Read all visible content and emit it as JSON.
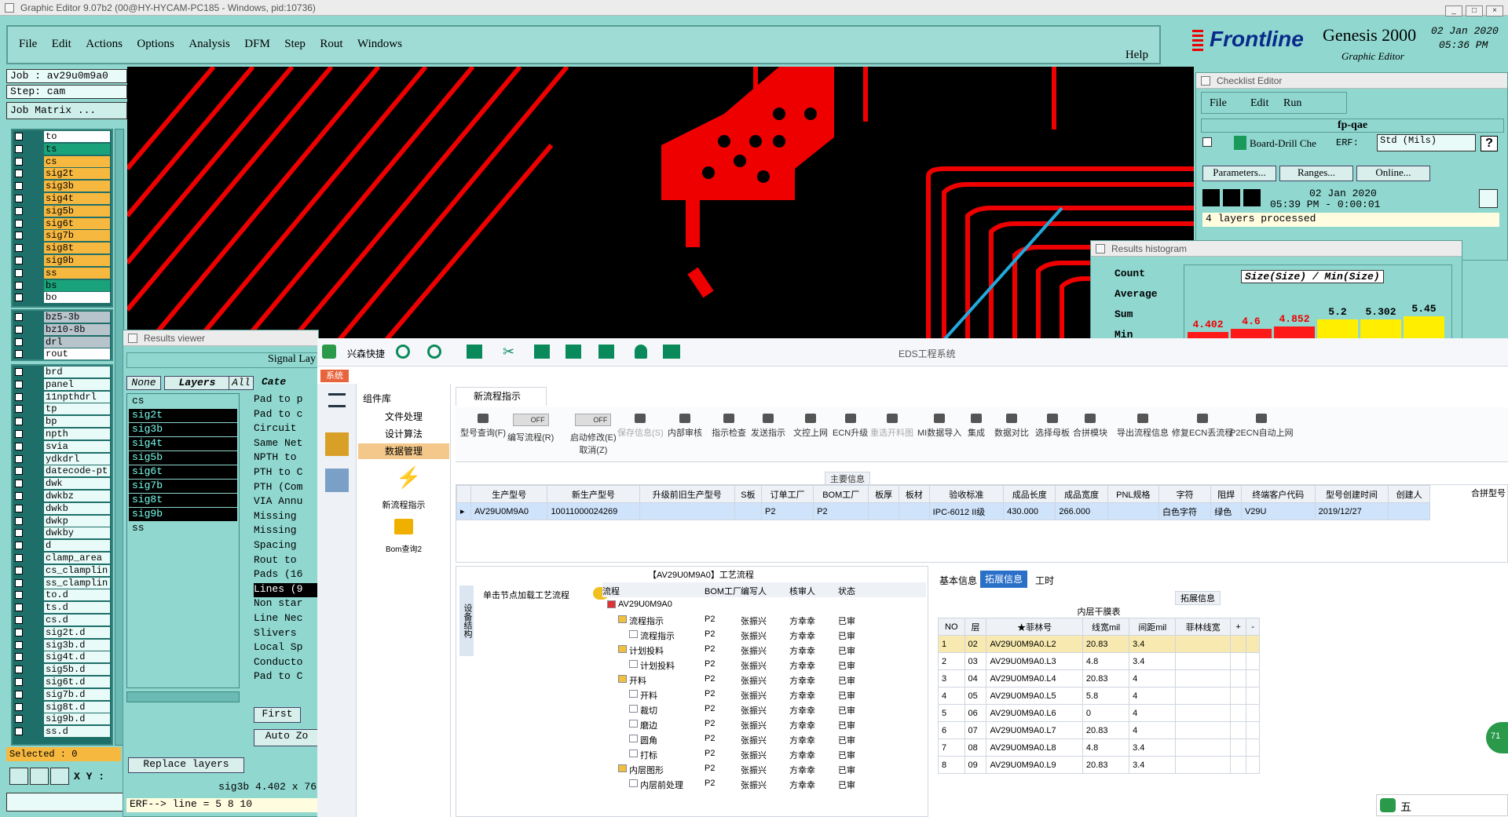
{
  "ge": {
    "title": "Graphic Editor 9.07b2 (00@HY-HYCAM-PC185 - Windows, pid:10736)",
    "menu": [
      "File",
      "Edit",
      "Actions",
      "Options",
      "Analysis",
      "DFM",
      "Step",
      "Rout",
      "Windows"
    ],
    "help": "Help"
  },
  "genesis": {
    "brand": "Frontline",
    "product": "Genesis 2000",
    "subtitle": "Graphic Editor",
    "date": "02 Jan 2020",
    "time": "05:36 PM"
  },
  "left": {
    "job": "Job : av29u0m9a0",
    "step": "Step: cam",
    "job_matrix": "Job Matrix ...",
    "selected": "Selected : 0",
    "xy": "X Y :"
  },
  "layers_a": [
    {
      "n": "to",
      "c": "#ffffff"
    },
    {
      "n": "ts",
      "c": "#1aa37a"
    },
    {
      "n": "cs",
      "c": "#f7b840"
    },
    {
      "n": "sig2t",
      "c": "#f7b840"
    },
    {
      "n": "sig3b",
      "c": "#f7b840"
    },
    {
      "n": "sig4t",
      "c": "#f7b840"
    },
    {
      "n": "sig5b",
      "c": "#f7b840"
    },
    {
      "n": "sig6t",
      "c": "#f7b840"
    },
    {
      "n": "sig7b",
      "c": "#f7b840"
    },
    {
      "n": "sig8t",
      "c": "#f7b840"
    },
    {
      "n": "sig9b",
      "c": "#f7b840"
    },
    {
      "n": "ss",
      "c": "#f7b840"
    },
    {
      "n": "bs",
      "c": "#1aa37a"
    },
    {
      "n": "bo",
      "c": "#ffffff"
    }
  ],
  "layers_b": [
    {
      "n": "bz5-3b",
      "c": "#b8c4cc"
    },
    {
      "n": "bz10-8b",
      "c": "#b8c4cc"
    },
    {
      "n": "drl",
      "c": "#b8c4cc"
    },
    {
      "n": "rout",
      "c": "#ffffff"
    }
  ],
  "layers_c": [
    "brd",
    "panel",
    "11npthdrl",
    "tp",
    "bp",
    "npth",
    "svia",
    "ydkdrl",
    "datecode-pt",
    "dwk",
    "dwkbz",
    "dwkb",
    "dwkp",
    "dwkby",
    "d",
    "clamp_area",
    "cs_clamplin",
    "ss_clamplin",
    "to.d",
    "ts.d",
    "cs.d",
    "sig2t.d",
    "sig3b.d",
    "sig4t.d",
    "sig5b.d",
    "sig6t.d",
    "sig7b.d",
    "sig8t.d",
    "sig9b.d",
    "ss.d"
  ],
  "checklist": {
    "title": "Checklist Editor",
    "menu": [
      "File",
      "Edit",
      "Run"
    ],
    "name": "fp-qae",
    "action": "Board-Drill Che",
    "erf": "ERF:",
    "std": "Std (Mils)",
    "q": "?",
    "btns": [
      "Parameters...",
      "Ranges...",
      "Online..."
    ],
    "date": "02 Jan 2020",
    "time": "05:39 PM - 0:00:01",
    "status": "4 layers processed"
  },
  "histogram": {
    "title": "Results histogram",
    "modes": [
      "Count",
      "Average",
      "Sum",
      "Min"
    ],
    "label": "Size(Size) / Min(Size)",
    "bars": [
      {
        "v": "4.402",
        "h": 0.16,
        "c": "#ff1a1a"
      },
      {
        "v": "4.6",
        "h": 0.22,
        "c": "#ff1a1a"
      },
      {
        "v": "4.852",
        "h": 0.26,
        "c": "#ff1a1a"
      },
      {
        "v": "5.2",
        "h": 0.4,
        "c": "#ffee00"
      },
      {
        "v": "5.302",
        "h": 0.4,
        "c": "#ffee00"
      },
      {
        "v": "5.45",
        "h": 0.45,
        "c": "#ffee00"
      }
    ]
  },
  "rv": {
    "title": "Results viewer",
    "signal": "Signal Lay",
    "none": "None",
    "layers": "Layers",
    "all": "All",
    "cate": "Cate",
    "list": [
      "cs",
      "sig2t",
      "sig3b",
      "sig4t",
      "sig5b",
      "sig6t",
      "sig7b",
      "sig8t",
      "sig9b",
      "ss"
    ],
    "cats": [
      "Pad to p",
      "Pad to c",
      "Circuit",
      "Same Net",
      "NPTH to",
      "PTH to C",
      "PTH (Com",
      "VIA Annu",
      "Missing",
      "Missing",
      "Spacing",
      "Rout to",
      "Pads (16",
      "Lines (9",
      "Non star",
      "Line Nec",
      "Slivers",
      "Local Sp",
      "Conducto",
      "Pad to C"
    ],
    "first": "First",
    "replace": "Replace layers",
    "status": "sig3b 4.402 x 76",
    "erf": "ERF--> line = 5 8 10"
  },
  "eds": {
    "app": "兴森快捷",
    "title": "EDS工程系统",
    "sys": "系统",
    "lib": "组件库",
    "nav": [
      "文件处理",
      "设计算法",
      "数据管理"
    ],
    "flow_tab": "新流程指示",
    "b1": "新流程指示",
    "b2": "Bom查询2",
    "tools": [
      "型号查询(F)",
      "编写流程(R)",
      "启动修改(E)\n取消(Z)",
      "保存信息(S)",
      "内部审核",
      "指示检查",
      "发送指示",
      "文控上网",
      "ECN升级",
      "重选开料图",
      "MI数据导入",
      "集成",
      "数据对比",
      "选择母板",
      "合拼模块",
      "导出流程信息",
      "修复ECN丢流程",
      "P2ECN自动上网"
    ],
    "off": "OFF",
    "main_info": "主要信息",
    "merge": "合拼型号",
    "cols": [
      "生产型号",
      "新生产型号",
      "升级前旧生产型号",
      "S板",
      "订单工厂",
      "BOM工厂",
      "板厚",
      "板材",
      "验收标准",
      "成品长度",
      "成品宽度",
      "PNL规格",
      "字符",
      "阻焊",
      "终端客户代码",
      "型号创建时间",
      "创建人"
    ],
    "row": [
      "AV29U0M9A0",
      "10011000024269",
      "",
      "",
      "P2",
      "P2",
      "",
      "",
      "IPC-6012 II级",
      "430.000",
      "266.000",
      "",
      "白色字符",
      "绿色",
      "V29U",
      "2019/12/27",
      ""
    ],
    "proc_title": "【AV29U0M9A0】工艺流程",
    "struct": "设备结构",
    "load": "单击节点加载工艺流程",
    "tree_cols": [
      "流程",
      "BOM工厂",
      "编写人",
      "核审人",
      "状态"
    ],
    "tree": [
      [
        "AV29U0M9A0",
        "",
        "",
        "",
        "",
        0
      ],
      [
        "流程指示",
        "P2",
        "张振兴",
        "方幸幸",
        "已审",
        1
      ],
      [
        "流程指示",
        "P2",
        "张振兴",
        "方幸幸",
        "已审",
        2
      ],
      [
        "计划投料",
        "P2",
        "张振兴",
        "方幸幸",
        "已审",
        1
      ],
      [
        "计划投料",
        "P2",
        "张振兴",
        "方幸幸",
        "已审",
        2
      ],
      [
        "开料",
        "P2",
        "张振兴",
        "方幸幸",
        "已审",
        1
      ],
      [
        "开料",
        "P2",
        "张振兴",
        "方幸幸",
        "已审",
        2
      ],
      [
        "裁切",
        "P2",
        "张振兴",
        "方幸幸",
        "已审",
        2
      ],
      [
        "磨边",
        "P2",
        "张振兴",
        "方幸幸",
        "已审",
        2
      ],
      [
        "圆角",
        "P2",
        "张振兴",
        "方幸幸",
        "已审",
        2
      ],
      [
        "打标",
        "P2",
        "张振兴",
        "方幸幸",
        "已审",
        2
      ],
      [
        "内层图形",
        "P2",
        "张振兴",
        "方幸幸",
        "已审",
        1
      ],
      [
        "内层前处理",
        "P2",
        "张振兴",
        "方幸幸",
        "已审",
        2
      ]
    ],
    "rtabs": [
      "基本信息",
      "拓展信息",
      "工时"
    ],
    "ext": "拓展信息",
    "film": "内层干膜表",
    "film_cols": [
      "NO",
      "层",
      "★菲林号",
      "线宽mil",
      "间距mil",
      "菲林线宽",
      "+",
      "-"
    ],
    "film_rows": [
      [
        "1",
        "02",
        "AV29U0M9A0.L2",
        "20.83",
        "3.4"
      ],
      [
        "2",
        "03",
        "AV29U0M9A0.L3",
        "4.8",
        "3.4"
      ],
      [
        "3",
        "04",
        "AV29U0M9A0.L4",
        "20.83",
        "4"
      ],
      [
        "4",
        "05",
        "AV29U0M9A0.L5",
        "5.8",
        "4"
      ],
      [
        "5",
        "06",
        "AV29U0M9A0.L6",
        "0",
        "4"
      ],
      [
        "6",
        "07",
        "AV29U0M9A0.L7",
        "20.83",
        "4"
      ],
      [
        "7",
        "08",
        "AV29U0M9A0.L8",
        "4.8",
        "3.4"
      ],
      [
        "8",
        "09",
        "AV29U0M9A0.L9",
        "20.83",
        "3.4"
      ]
    ],
    "ime": "五",
    "badge": "71"
  }
}
